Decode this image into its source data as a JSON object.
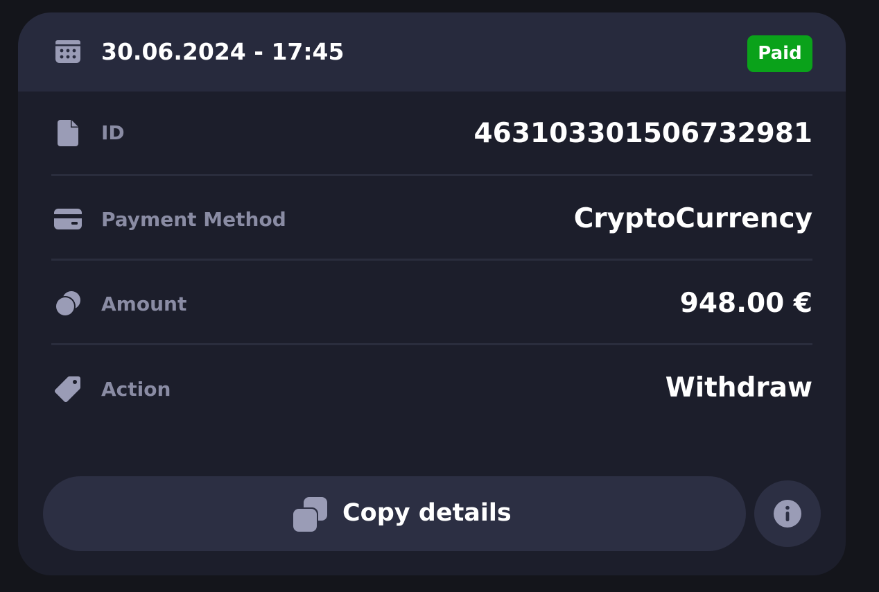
{
  "header": {
    "date": "30.06.2024 - 17:45",
    "icon": "calendar-icon",
    "status": "Paid",
    "status_color": "#0aa21a"
  },
  "rows": [
    {
      "icon": "document-icon",
      "label": "ID",
      "value": "463103301506732981"
    },
    {
      "icon": "card-icon",
      "label": "Payment Method",
      "value": "CryptoCurrency"
    },
    {
      "icon": "coins-icon",
      "label": "Amount",
      "value": "948.00 €"
    },
    {
      "icon": "tag-icon",
      "label": "Action",
      "value": "Withdraw"
    }
  ],
  "actions": {
    "copy_label": "Copy details",
    "copy_icon": "copy-icon",
    "info_icon": "info-icon"
  },
  "colors": {
    "background": "#14151b",
    "card": "#1c1e2b",
    "header": "#272a3d",
    "button": "#2c2f43",
    "label": "#8a8ca4",
    "icon": "#9a9cb6"
  }
}
